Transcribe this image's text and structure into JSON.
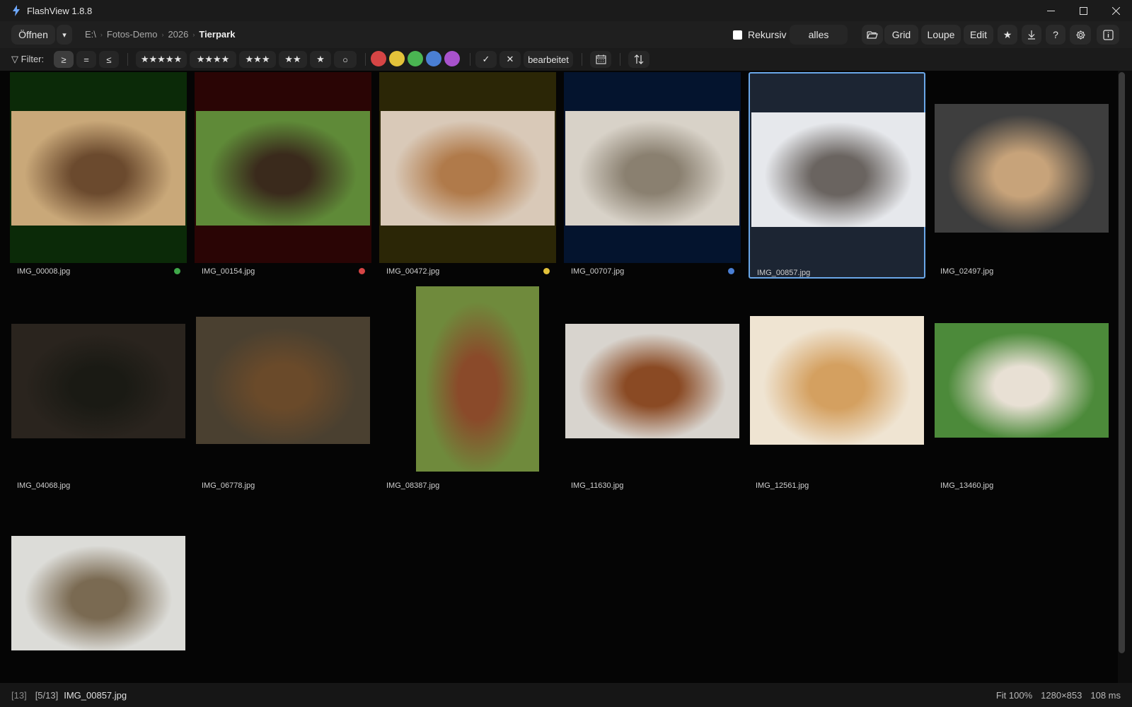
{
  "window": {
    "title": "FlashView 1.8.8"
  },
  "toolbar": {
    "open_label": "Öffnen",
    "open_dropdown": "▾",
    "breadcrumb": [
      "E:\\",
      "Fotos-Demo",
      "2026",
      "Tierpark"
    ],
    "breadcrumb_sep": "›",
    "recursive_label": "Rekursiv",
    "scope_value": "alles",
    "views": [
      "Grid",
      "Loupe",
      "Edit"
    ],
    "active_view": "Grid",
    "icons": [
      "folder-open-icon",
      "star-icon",
      "download-icon",
      "help-icon",
      "settings-icon",
      "info-panel-icon"
    ],
    "help_label": "?",
    "star_label": "★"
  },
  "filter": {
    "label": "Filter:",
    "comparators": [
      "≥",
      "=",
      "≤"
    ],
    "active_comparator": "≥",
    "ratings": [
      "★★★★★",
      "★★★★",
      "★★★",
      "★★",
      "★",
      "○"
    ],
    "colors": [
      "#d64545",
      "#e3c23a",
      "#4ab552",
      "#4a7fd4",
      "#a852cc"
    ],
    "accept_label": "✓",
    "reject_label": "✕",
    "edited_label": "bearbeitet",
    "icons": [
      "calendar-icon",
      "sort-icon"
    ]
  },
  "grid": {
    "selected_index": 4,
    "items": [
      {
        "name": "IMG_00008.jpg",
        "label_color": "#3fa84a",
        "band": "#0b2a08",
        "orient": "landscape"
      },
      {
        "name": "IMG_00154.jpg",
        "label_color": "#d64545",
        "band": "#2a0505",
        "orient": "landscape"
      },
      {
        "name": "IMG_00472.jpg",
        "label_color": "#e3c23a",
        "band": "#2b2606",
        "orient": "landscape"
      },
      {
        "name": "IMG_00707.jpg",
        "label_color": "#4a7fd4",
        "band": "#04142e",
        "orient": "landscape"
      },
      {
        "name": "IMG_00857.jpg",
        "label_color": "",
        "band": "",
        "orient": "landscape"
      },
      {
        "name": "IMG_02497.jpg",
        "label_color": "",
        "band": "",
        "orient": "landscape"
      },
      {
        "name": "IMG_04068.jpg",
        "label_color": "",
        "band": "",
        "orient": "landscape"
      },
      {
        "name": "IMG_06778.jpg",
        "label_color": "",
        "band": "",
        "orient": "landscape"
      },
      {
        "name": "IMG_08387.jpg",
        "label_color": "",
        "band": "",
        "orient": "portrait"
      },
      {
        "name": "IMG_11630.jpg",
        "label_color": "",
        "band": "",
        "orient": "landscape"
      },
      {
        "name": "IMG_12561.jpg",
        "label_color": "",
        "band": "",
        "orient": "landscape"
      },
      {
        "name": "IMG_13460.jpg",
        "label_color": "",
        "band": "",
        "orient": "landscape"
      },
      {
        "name": "",
        "label_color": "",
        "band": "",
        "orient": "landscape"
      }
    ]
  },
  "status": {
    "count": "[13]",
    "position": "[5/13]",
    "filename": "IMG_00857.jpg",
    "zoom": "Fit 100%",
    "dimensions": "1280×853",
    "load_time": "108 ms"
  }
}
